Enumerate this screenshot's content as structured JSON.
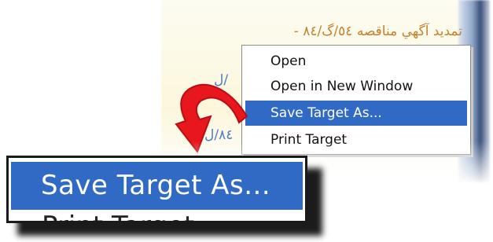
{
  "page": {
    "link_title": "تمديد آگهي مناقصه ٥٤/گ/٨٤ -",
    "link_fragments": [
      "ل/",
      "٨٤/ل"
    ]
  },
  "context_menu": {
    "items": [
      {
        "label": "Open",
        "highlighted": false
      },
      {
        "label": "Open in New Window",
        "highlighted": false
      },
      {
        "label": "Save Target As...",
        "highlighted": true
      },
      {
        "label": "Print Target",
        "highlighted": false
      }
    ]
  },
  "zoom_callout": {
    "highlighted_label": "Save Target As...",
    "next_label": "Print Target"
  },
  "colors": {
    "highlight": "#316ac5",
    "arrow": "#e8171d",
    "link_title": "#c7812e",
    "link": "#4a7ec4"
  },
  "icons": [
    "curved-arrow-icon"
  ]
}
